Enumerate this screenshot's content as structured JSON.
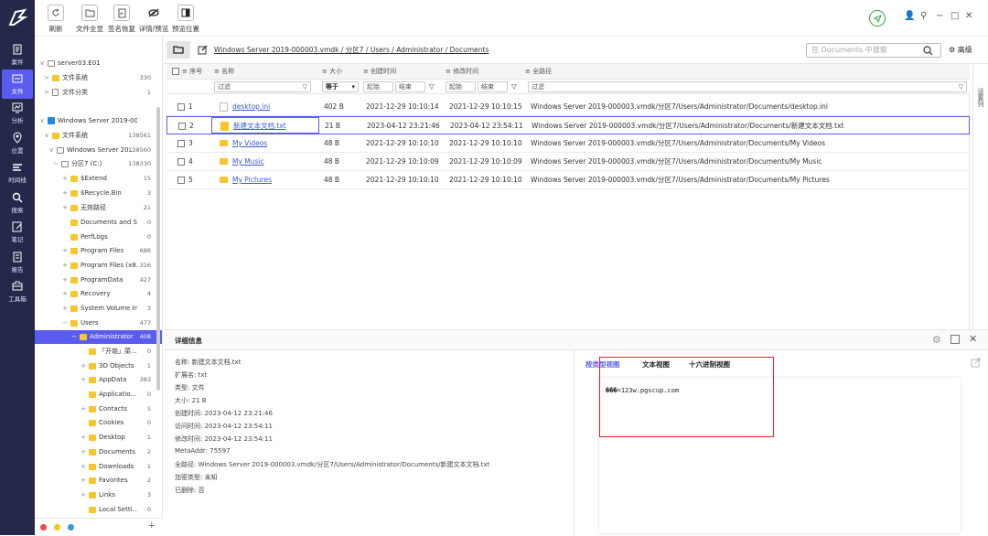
{
  "toolbar": {
    "refresh": "刷新",
    "select_all": "文件全显",
    "signature": "签名恢复",
    "detail_preview": "详情/预览",
    "preview_pos": "预览位置"
  },
  "nav": [
    {
      "label": "案件",
      "icon": "case-icon"
    },
    {
      "label": "文件",
      "icon": "folder-icon"
    },
    {
      "label": "分析",
      "icon": "analysis-icon"
    },
    {
      "label": "位置",
      "icon": "location-icon"
    },
    {
      "label": "时间线",
      "icon": "timeline-icon"
    },
    {
      "label": "搜索",
      "icon": "search-icon"
    },
    {
      "label": "笔记",
      "icon": "note-icon"
    },
    {
      "label": "报告",
      "icon": "report-icon"
    },
    {
      "label": "工具箱",
      "icon": "toolbox-icon"
    }
  ],
  "tree": [
    {
      "toggle": "∨",
      "label": "server03.E01",
      "count": ""
    },
    {
      "toggle": ">",
      "label": "文件系统",
      "count": "330"
    },
    {
      "toggle": ">",
      "label": "文件分类",
      "count": "1"
    },
    {
      "toggle": "∨",
      "label": "Windows Server 2019-000000...",
      "count": ""
    },
    {
      "toggle": "∨",
      "label": "文件系统",
      "count": "138561"
    },
    {
      "toggle": "∨",
      "label": "Windows Server 20...",
      "count": "138560"
    },
    {
      "toggle": "−",
      "label": "分区7 (C:)",
      "count": "138330"
    },
    {
      "toggle": "+",
      "label": "$Extend",
      "count": "15"
    },
    {
      "toggle": "+",
      "label": "$Recycle.Bin",
      "count": "3"
    },
    {
      "toggle": "+",
      "label": "无效路径",
      "count": "21"
    },
    {
      "toggle": "",
      "label": "Documents and Set...",
      "count": "0"
    },
    {
      "toggle": "",
      "label": "PerfLogs",
      "count": "0"
    },
    {
      "toggle": "+",
      "label": "Program Files",
      "count": "686"
    },
    {
      "toggle": "+",
      "label": "Program Files (x8...",
      "count": "316"
    },
    {
      "toggle": "+",
      "label": "ProgramData",
      "count": "427"
    },
    {
      "toggle": "+",
      "label": "Recovery",
      "count": "4"
    },
    {
      "toggle": "+",
      "label": "System Volume Inf...",
      "count": "3"
    },
    {
      "toggle": "−",
      "label": "Users",
      "count": "477"
    },
    {
      "toggle": "−",
      "label": "Administrator",
      "count": "408"
    },
    {
      "toggle": "",
      "label": "「开始」菜...",
      "count": "0"
    },
    {
      "toggle": "+",
      "label": "3D Objects",
      "count": "1"
    },
    {
      "toggle": "+",
      "label": "AppData",
      "count": "383"
    },
    {
      "toggle": "",
      "label": "Applicatio...",
      "count": "0"
    },
    {
      "toggle": "+",
      "label": "Contacts",
      "count": "1"
    },
    {
      "toggle": "",
      "label": "Cookies",
      "count": "0"
    },
    {
      "toggle": "+",
      "label": "Desktop",
      "count": "1"
    },
    {
      "toggle": "+",
      "label": "Documents",
      "count": "2"
    },
    {
      "toggle": "+",
      "label": "Downloads",
      "count": "1"
    },
    {
      "toggle": "+",
      "label": "Favorites",
      "count": "2"
    },
    {
      "toggle": "+",
      "label": "Links",
      "count": "3"
    },
    {
      "toggle": "",
      "label": "Local Setti...",
      "count": "0"
    }
  ],
  "tree_footer_plus": "∔",
  "path": {
    "segments": [
      "Windows Server 2019-000003.vmdk",
      "分区7",
      "Users",
      "Administrator",
      "Documents"
    ],
    "separator": " / ",
    "search_placeholder": "在 Documents 中搜索",
    "advanced": "高级"
  },
  "grid": {
    "headers": {
      "index": "序号",
      "name": "名称",
      "size": "大小",
      "created": "创建时间",
      "modified": "修改时间",
      "fullpath": "全路径"
    },
    "filter": {
      "name": "过滤",
      "size": "等于",
      "start": "起始",
      "end": "结束",
      "start2": "起始",
      "end2": "结束",
      "path": "过滤"
    },
    "side_label": "设置列",
    "rows": [
      {
        "index": "1",
        "name": "desktop.ini",
        "size": "402 B",
        "created": "2021-12-29 10:10:14",
        "modified": "2021-12-29 10:10:15",
        "path": "Windows Server 2019-000003.vmdk/分区7/Users/Administrator/Documents/desktop.ini",
        "type": "doc"
      },
      {
        "index": "2",
        "name": "新建文本文档.txt",
        "size": "21 B",
        "created": "2023-04-12 23:21:46",
        "modified": "2023-04-12 23:54:11",
        "path": "Windows Server 2019-000003.vmdk/分区7/Users/Administrator/Documents/新建文本文档.txt",
        "type": "txt"
      },
      {
        "index": "3",
        "name": "My Videos",
        "size": "48 B",
        "created": "2021-12-29 10:10:10",
        "modified": "2021-12-29 10:10:10",
        "path": "Windows Server 2019-000003.vmdk/分区7/Users/Administrator/Documents/My Videos",
        "type": "folder"
      },
      {
        "index": "4",
        "name": "My Music",
        "size": "48 B",
        "created": "2021-12-29 10:10:09",
        "modified": "2021-12-29 10:10:09",
        "path": "Windows Server 2019-000003.vmdk/分区7/Users/Administrator/Documents/My Music",
        "type": "folder"
      },
      {
        "index": "5",
        "name": "My Pictures",
        "size": "48 B",
        "created": "2021-12-29 10:10:10",
        "modified": "2021-12-29 10:10:10",
        "path": "Windows Server 2019-000003.vmdk/分区7/Users/Administrator/Documents/My Pictures",
        "type": "folder"
      }
    ]
  },
  "detail": {
    "title": "详细信息",
    "lines": [
      "名称: 新建文本文档.txt",
      "扩展名: txt",
      "类型: 文件",
      "大小: 21 B",
      "创建时间: 2023-04-12 23:21:46",
      "访问时间: 2023-04-12 23:54:11",
      "修改时间: 2023-04-12 23:54:11",
      "MetaAddr: 75597",
      "全路径: Windows Server 2019-000003.vmdk/分区7/Users/Administrator/Documents/新建文本文档.txt",
      "加密类型: 未知",
      "已删除: 否"
    ],
    "tabs": {
      "type_view": "按类型视图",
      "text_view": "文本视图",
      "hex_view": "十六进制视图"
    },
    "preview_text": "���=123w.pgscup.com"
  },
  "colors": {
    "sidebar": "#24284a",
    "accent": "#5a5cf0",
    "highlight": "#e0262c"
  }
}
